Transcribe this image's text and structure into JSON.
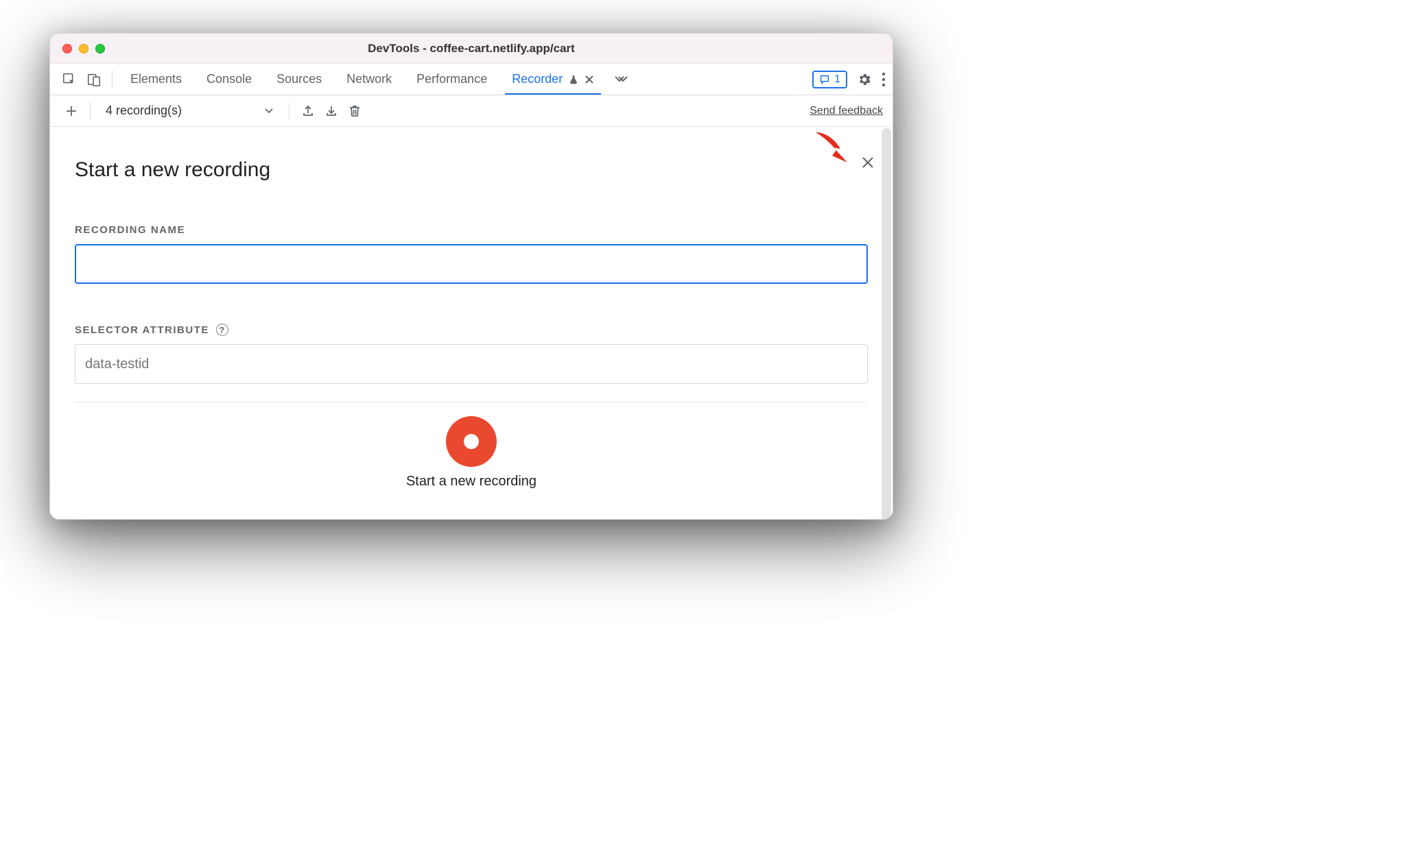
{
  "window": {
    "title": "DevTools - coffee-cart.netlify.app/cart"
  },
  "tabs": {
    "items": [
      {
        "label": "Elements"
      },
      {
        "label": "Console"
      },
      {
        "label": "Sources"
      },
      {
        "label": "Network"
      },
      {
        "label": "Performance"
      },
      {
        "label": "Recorder"
      }
    ],
    "active_index": 5
  },
  "badge": {
    "count": "1"
  },
  "toolbar": {
    "recordings_label": "4 recording(s)",
    "feedback_label": "Send feedback"
  },
  "panel": {
    "headline": "Start a new recording",
    "recording_name_label": "Recording Name",
    "recording_name_value": "",
    "selector_attr_label": "Selector Attribute",
    "selector_attr_placeholder": "data-testid",
    "record_caption": "Start a new recording"
  },
  "icons": {
    "help_glyph": "?"
  },
  "colors": {
    "accent": "#1a73e8",
    "record": "#e8492f"
  }
}
